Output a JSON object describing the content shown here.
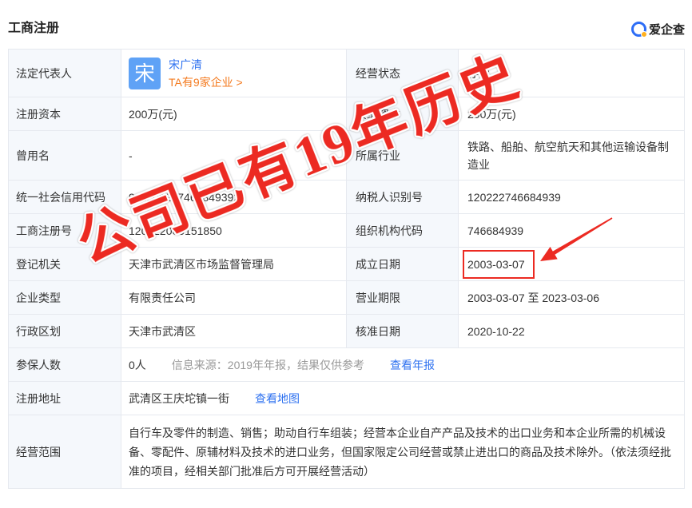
{
  "section": {
    "title": "工商注册"
  },
  "brand": {
    "name": "爱企查",
    "icon": "aiqicha-logo-icon"
  },
  "table": {
    "legal_rep": {
      "label": "法定代表人",
      "avatar_char": "宋",
      "name": "宋广清",
      "companies_link": "TA有9家企业 >"
    },
    "operating_status": {
      "label": "经营状态",
      "value": "存续"
    },
    "registered_capital": {
      "label": "注册资本",
      "value": "200万(元)"
    },
    "paid_in_capital": {
      "label": "实缴资本",
      "value": "200万(元)"
    },
    "former_name": {
      "label": "曾用名",
      "value": "-"
    },
    "industry": {
      "label": "所属行业",
      "value": "铁路、船舶、航空航天和其他运输设备制造业"
    },
    "credit_code": {
      "label": "统一社会信用代码",
      "value": "911202227466849392"
    },
    "taxpayer_id": {
      "label": "纳税人识别号",
      "value": "120222746684939"
    },
    "registration_no": {
      "label": "工商注册号",
      "value": "120222000151850"
    },
    "org_code": {
      "label": "组织机构代码",
      "value": "746684939"
    },
    "authority": {
      "label": "登记机关",
      "value": "天津市武清区市场监督管理局"
    },
    "established": {
      "label": "成立日期",
      "value": "2003-03-07"
    },
    "company_type": {
      "label": "企业类型",
      "value": "有限责任公司"
    },
    "business_term": {
      "label": "营业期限",
      "value": "2003-03-07 至 2023-03-06"
    },
    "admin_region": {
      "label": "行政区划",
      "value": "天津市武清区"
    },
    "approval_date": {
      "label": "核准日期",
      "value": "2020-10-22"
    },
    "insured": {
      "label": "参保人数",
      "value": "0人",
      "source_note": "信息来源：2019年年报，结果仅供参考",
      "link": "查看年报"
    },
    "address": {
      "label": "注册地址",
      "value": "武清区王庆坨镇一街",
      "link": "查看地图"
    },
    "business_scope": {
      "label": "经营范围",
      "value": "自行车及零件的制造、销售；助动自行车组装；经营本企业自产产品及技术的出口业务和本企业所需的机械设备、零配件、原辅材料及技术的进口业务，但国家限定公司经营或禁止进出口的商品及技术除外。（依法须经批准的项目，经相关部门批准后方可开展经营活动）"
    }
  },
  "annotation": {
    "headline": "公司已有19年历史"
  },
  "colors": {
    "link": "#2f72f0",
    "orange_link": "#f47b20",
    "avatar": "#5fa2f6",
    "label_bg": "#f5f8fc",
    "border": "#e6e9ef",
    "muted": "#999999",
    "annotation_red": "#ec2a22",
    "brand_blue": "#2d6df6"
  }
}
